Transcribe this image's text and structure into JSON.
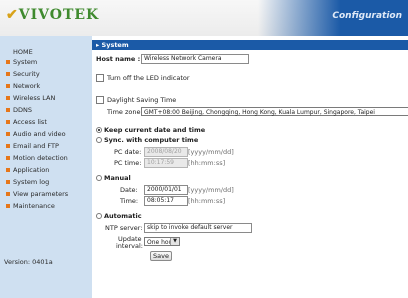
{
  "header": {
    "logo": "VIVOTEK",
    "section": "Configuration"
  },
  "sidebar": {
    "items": [
      {
        "label": "HOME"
      },
      {
        "label": "System"
      },
      {
        "label": "Security"
      },
      {
        "label": "Network"
      },
      {
        "label": "Wireless LAN"
      },
      {
        "label": "DDNS"
      },
      {
        "label": "Access list"
      },
      {
        "label": "Audio and video"
      },
      {
        "label": "Email and FTP"
      },
      {
        "label": "Motion detection"
      },
      {
        "label": "Application"
      },
      {
        "label": "System log"
      },
      {
        "label": "View parameters"
      },
      {
        "label": "Maintenance"
      }
    ],
    "version": "Version: 0401a"
  },
  "main": {
    "section_title": "System",
    "host_name_label": "Host name :",
    "host_name_value": "Wireless Network Camera",
    "led_label": "Turn off the LED indicator",
    "led_checked": false,
    "dst_label": "Daylight Saving Time",
    "dst_checked": false,
    "timezone_label": "Time zone:",
    "timezone_value": "GMT+08:00 Beijing, Chongqing, Hong Kong, Kuala Lumpur, Singapore, Taipei",
    "keep_label": "Keep current date and time",
    "sync_label": "Sync. with computer time",
    "pc_date_label": "PC date:",
    "pc_date_value": "2008/08/20",
    "date_hint": "[yyyy/mm/dd]",
    "pc_time_label": "PC time:",
    "pc_time_value": "10:17:59",
    "time_hint": "[hh:mm:ss]",
    "manual_label": "Manual",
    "date_label": "Date:",
    "date_value": "2000/01/01",
    "time_label": "Time:",
    "time_value": "08:05:17",
    "auto_label": "Automatic",
    "ntp_label": "NTP server:",
    "ntp_value": "skip to invoke default server",
    "update_label_1": "Update",
    "update_label_2": "interval:",
    "update_value": "One hour",
    "save_label": "Save",
    "selected_time_mode": "keep"
  },
  "colors": {
    "accent": "#1b5aa7",
    "sidebar_bg": "#cfe0f1",
    "bullet": "#e6761a",
    "logo": "#3f8a2e"
  }
}
